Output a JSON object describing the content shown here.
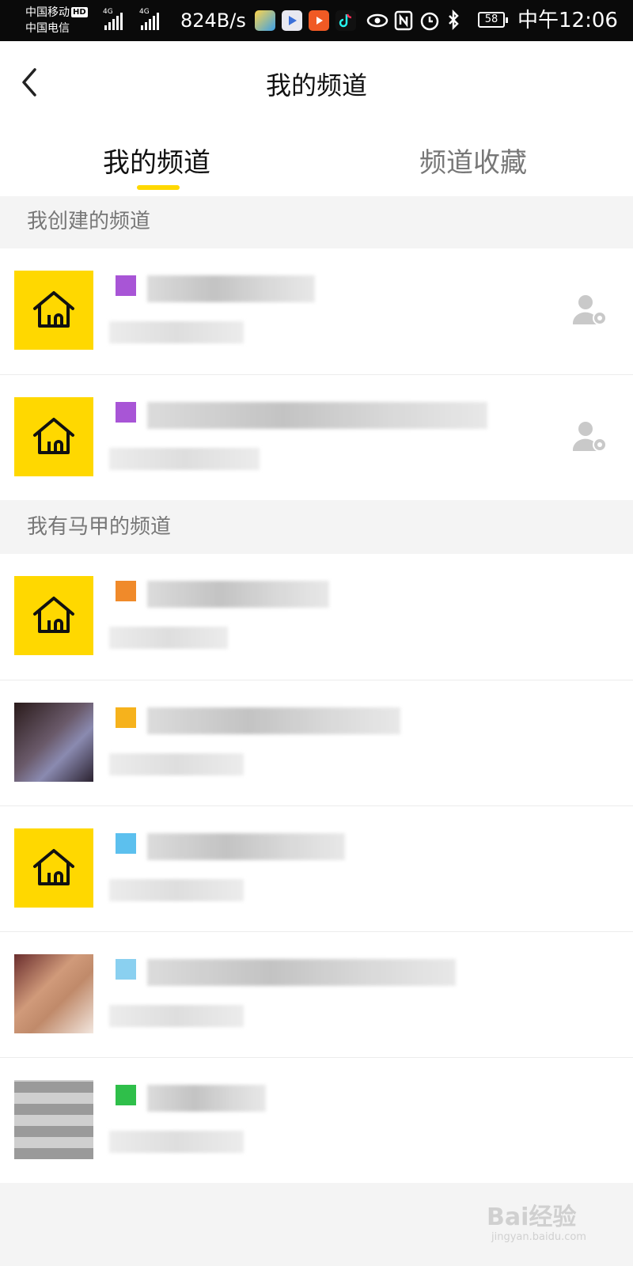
{
  "status_bar": {
    "carrier1": "中国移动",
    "hd": "HD",
    "carrier2": "中国电信",
    "net1": "4G",
    "net2": "4G",
    "speed": "824B/s",
    "battery": "58",
    "time": "中午12:06"
  },
  "header": {
    "title": "我的频道"
  },
  "tabs": [
    {
      "label": "我的频道",
      "active": true
    },
    {
      "label": "频道收藏",
      "active": false
    }
  ],
  "sections": {
    "created": "我创建的频道",
    "alt": "我有马甲的频道"
  },
  "colors": {
    "accent": "#ffd800",
    "tag_purple": "#a855d6",
    "tag_orange": "#f08a2a",
    "tag_amber": "#f6b21c",
    "tag_blue": "#5cc0ee",
    "tag_green": "#2fbf4a"
  },
  "created_channels": [
    {
      "avatar": "house-icon",
      "tag_color": "#a855d6",
      "manage_icon": "user-settings-icon"
    },
    {
      "avatar": "house-icon",
      "tag_color": "#a855d6",
      "manage_icon": "user-settings-icon"
    }
  ],
  "alt_channels": [
    {
      "avatar": "house-icon",
      "tag_color": "#f08a2a"
    },
    {
      "avatar": "photo",
      "tag_color": "#f6b21c"
    },
    {
      "avatar": "house-icon",
      "tag_color": "#5cc0ee"
    },
    {
      "avatar": "photo",
      "tag_color": "#8ad0f0"
    },
    {
      "avatar": "qr",
      "tag_color": "#2fbf4a"
    }
  ],
  "watermark": {
    "brand": "Bai经验",
    "url": "jingyan.baidu.com"
  }
}
